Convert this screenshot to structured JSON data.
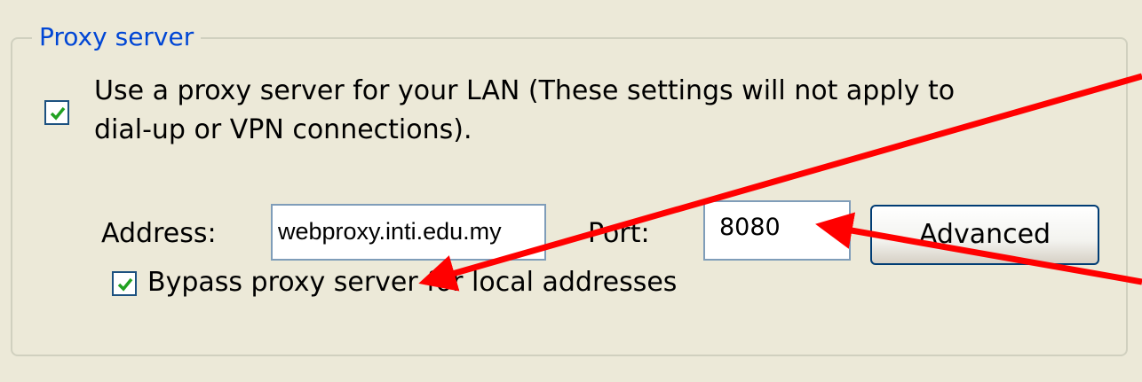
{
  "group": {
    "title": "Proxy server"
  },
  "use_proxy": {
    "checked": true,
    "label_line1": "Use a proxy server for your LAN (These settings will not apply to",
    "label_line2": "dial-up or VPN connections)."
  },
  "address": {
    "label": "Address:",
    "value": "webproxy.inti.edu.my"
  },
  "port": {
    "label": "Port:",
    "value": "8080"
  },
  "advanced_button": {
    "label": "Advanced"
  },
  "bypass": {
    "checked": true,
    "label": "Bypass proxy server for local addresses"
  },
  "colors": {
    "background": "#ECE9D8",
    "legend_text": "#0046D5",
    "check_mark": "#21A121",
    "annotation_arrow": "#FF0000"
  },
  "annotations": {
    "arrows": [
      "arrow-to-address-field",
      "arrow-to-port-field"
    ]
  }
}
